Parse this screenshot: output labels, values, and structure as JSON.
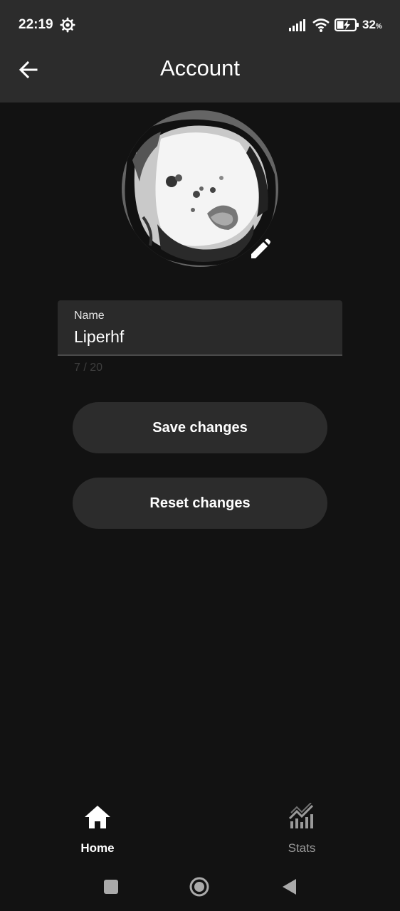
{
  "status_bar": {
    "time": "22:19",
    "battery_percent": "32",
    "battery_unit": "%",
    "icons": [
      "gear-icon",
      "signal-icon",
      "wifi-icon",
      "battery-charging-icon"
    ]
  },
  "header": {
    "title": "Account",
    "back_icon": "arrow-left-icon"
  },
  "profile": {
    "avatar_icon": "avatar-image",
    "edit_icon": "pencil-icon"
  },
  "name_field": {
    "label": "Name",
    "value": "Liperhf",
    "counter": "7 / 20"
  },
  "actions": {
    "save_label": "Save changes",
    "reset_label": "Reset changes"
  },
  "bottom_nav": {
    "items": [
      {
        "label": "Home",
        "icon": "home-icon",
        "active": true
      },
      {
        "label": "Stats",
        "icon": "stats-icon",
        "active": false
      }
    ]
  },
  "colors": {
    "background": "#121212",
    "surface": "#2c2c2c",
    "field": "#2a2a2a",
    "text": "#ffffff",
    "inactive": "#9a9a9a"
  }
}
